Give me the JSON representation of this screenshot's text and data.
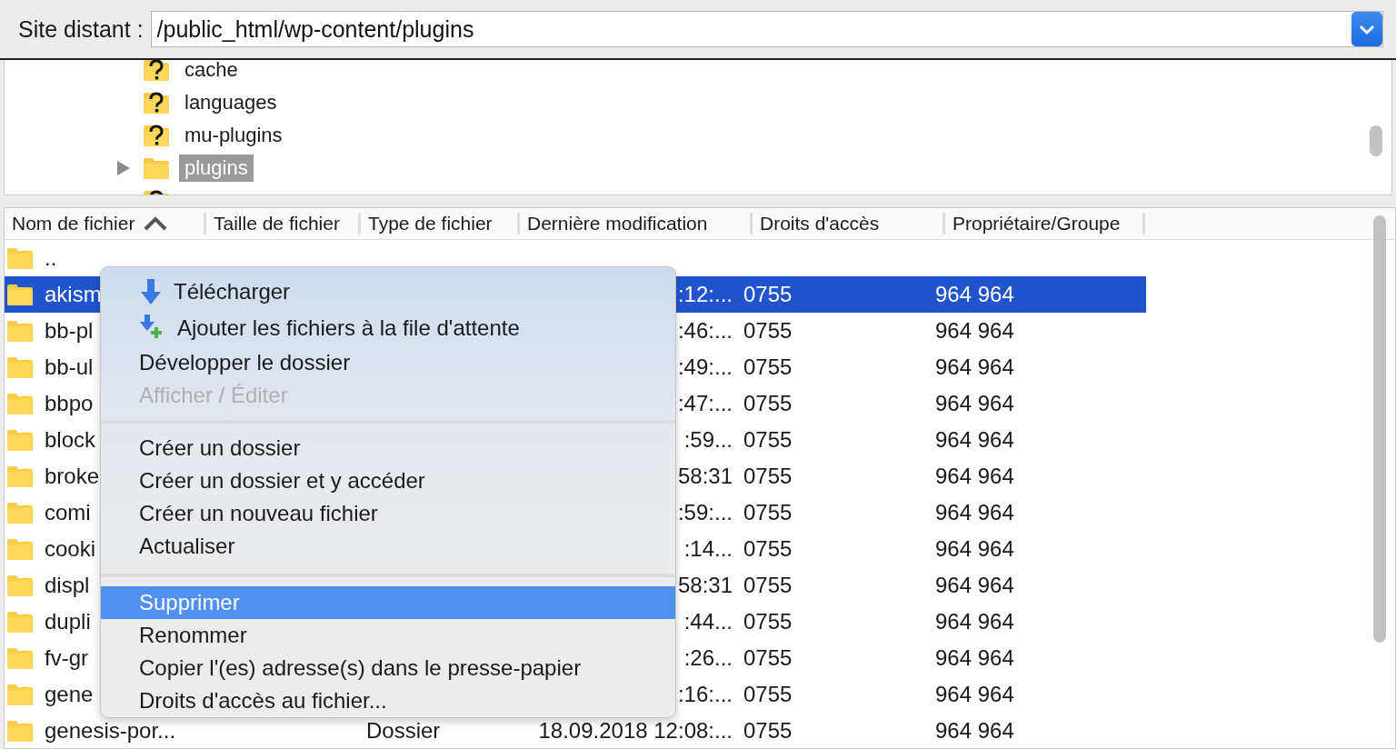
{
  "address_bar": {
    "label": "Site distant :",
    "value": "/public_html/wp-content/plugins"
  },
  "tree": {
    "items": [
      {
        "label": "cache",
        "kind": "unknown",
        "expandable": false,
        "selected": false
      },
      {
        "label": "languages",
        "kind": "unknown",
        "expandable": false,
        "selected": false
      },
      {
        "label": "mu-plugins",
        "kind": "unknown",
        "expandable": false,
        "selected": false
      },
      {
        "label": "plugins",
        "kind": "folder",
        "expandable": true,
        "selected": true
      },
      {
        "kind": "unknown",
        "expandable": false
      }
    ]
  },
  "file_list": {
    "columns": [
      {
        "label": "Nom de fichier",
        "sorted": true
      },
      {
        "label": "Taille de fichier",
        "sorted": false
      },
      {
        "label": "Type de fichier",
        "sorted": false
      },
      {
        "label": "Dernière modification",
        "sorted": false
      },
      {
        "label": "Droits d'accès",
        "sorted": false
      },
      {
        "label": "Propriétaire/Groupe",
        "sorted": false
      }
    ],
    "rows": [
      {
        "name": "..",
        "selected": false
      },
      {
        "name": "akism",
        "modified": ":12:...",
        "permissions": "0755",
        "owner": "964 964",
        "selected": true
      },
      {
        "name": "bb-pl",
        "modified": ":46:...",
        "permissions": "0755",
        "owner": "964 964",
        "selected": false
      },
      {
        "name": "bb-ul",
        "modified": ":49:...",
        "permissions": "0755",
        "owner": "964 964",
        "selected": false
      },
      {
        "name": "bbpo",
        "modified": ":47:...",
        "permissions": "0755",
        "owner": "964 964",
        "selected": false
      },
      {
        "name": "block",
        "modified": ":59...",
        "permissions": "0755",
        "owner": "964 964",
        "selected": false
      },
      {
        "name": "broke",
        "modified": "58:31",
        "permissions": "0755",
        "owner": "964 964",
        "selected": false
      },
      {
        "name": "comi",
        "modified": ":59:...",
        "permissions": "0755",
        "owner": "964 964",
        "selected": false
      },
      {
        "name": "cooki",
        "modified": ":14...",
        "permissions": "0755",
        "owner": "964 964",
        "selected": false
      },
      {
        "name": "displ",
        "modified": "58:31",
        "permissions": "0755",
        "owner": "964 964",
        "selected": false
      },
      {
        "name": "dupli",
        "modified": ":44...",
        "permissions": "0755",
        "owner": "964 964",
        "selected": false
      },
      {
        "name": "fv-gr",
        "modified": ":26...",
        "permissions": "0755",
        "owner": "964 964",
        "selected": false
      },
      {
        "name": "gene",
        "modified": ":16:...",
        "permissions": "0755",
        "owner": "964 964",
        "selected": false
      },
      {
        "name": "genesis-por...",
        "type": "Dossier",
        "modified": "18.09.2018 12:08:...",
        "permissions": "0755",
        "owner": "964 964",
        "selected": false
      }
    ]
  },
  "context_menu": {
    "items": [
      {
        "kind": "download",
        "label": "Télécharger",
        "disabled": false,
        "selected": false
      },
      {
        "kind": "queue",
        "label": "Ajouter les fichiers à la file d'attente",
        "disabled": false,
        "selected": false
      },
      {
        "kind": "text",
        "label": "Développer le dossier",
        "disabled": false,
        "selected": false
      },
      {
        "kind": "text",
        "label": "Afficher / Éditer",
        "disabled": true,
        "selected": false
      },
      {
        "kind": "separator"
      },
      {
        "kind": "text",
        "label": "Créer un dossier",
        "disabled": false,
        "selected": false
      },
      {
        "kind": "text",
        "label": "Créer un dossier et y accéder",
        "disabled": false,
        "selected": false
      },
      {
        "kind": "text",
        "label": "Créer un nouveau fichier",
        "disabled": false,
        "selected": false
      },
      {
        "kind": "text",
        "label": "Actualiser",
        "disabled": false,
        "selected": false
      },
      {
        "kind": "separator"
      },
      {
        "kind": "text",
        "label": "Supprimer",
        "disabled": false,
        "selected": true
      },
      {
        "kind": "text",
        "label": "Renommer",
        "disabled": false,
        "selected": false
      },
      {
        "kind": "text",
        "label": "Copier l'(es) adresse(s) dans le presse-papier",
        "disabled": false,
        "selected": false
      },
      {
        "kind": "text",
        "label": "Droits d'accès au fichier...",
        "disabled": false,
        "selected": false
      }
    ]
  }
}
